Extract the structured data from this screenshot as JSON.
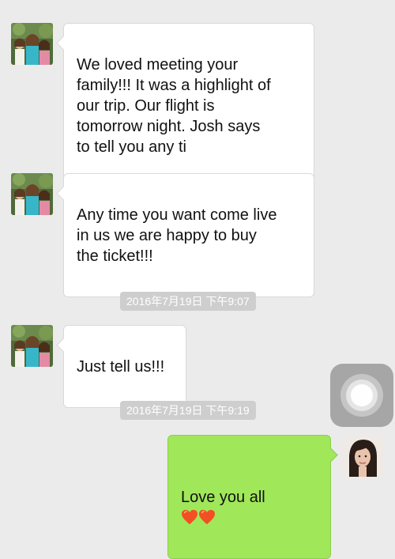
{
  "messages": [
    {
      "direction": "incoming",
      "text": "We loved meeting your\nfamily!!!  It was a highlight of\n our trip.  Our flight is\ntomorrow night.  Josh says\nto tell you any ti"
    },
    {
      "direction": "incoming",
      "text": "Any time you want come live\n in us we are happy to buy\nthe ticket!!!"
    },
    {
      "direction": "incoming",
      "text": "Just tell us!!!"
    },
    {
      "direction": "outgoing",
      "text": "Love you all",
      "emoji": [
        "red-heart-icon",
        "red-heart-icon"
      ]
    }
  ],
  "timestamps": [
    "2016年7月19日 下午9:07",
    "2016年7月19日 下午9:19"
  ],
  "colors": {
    "background": "#ebebeb",
    "incoming_bubble": "#ffffff",
    "outgoing_bubble": "#a0e75a",
    "timestamp_pill": "#cecece",
    "heart": "#f25022"
  },
  "icons": {
    "contact_avatar": "group-photo-avatar-icon",
    "own_avatar": "portrait-avatar-icon",
    "assistive_touch": "assistive-touch-icon"
  }
}
